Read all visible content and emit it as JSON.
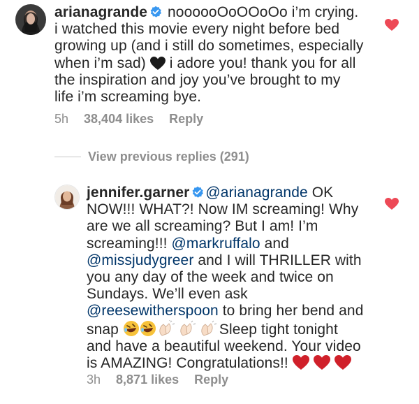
{
  "comment1": {
    "username": "arianagrande",
    "lines": [
      " noooooOoOOoOo i’m crying.",
      "i watched this movie every night before bed",
      "growing up (and i still do sometimes, especially",
      "when i’m sad)",
      " i adore you! thank you for all",
      "the inspiration and joy you’ve brought to my",
      "life i’m screaming bye."
    ],
    "time": "5h",
    "likes": "38,404 likes",
    "reply": "Reply"
  },
  "view_previous": "View previous replies (291)",
  "comment2": {
    "username": "jennifer.garner",
    "mention_ariana": "@arianagrande",
    "line1_tail": " OK",
    "lines": [
      "NOW!!! WHAT?! Now IM screaming!  Why",
      "are we all screaming? But I am! I’m",
      "screaming!!! ",
      " and",
      " and I will THRILLER with",
      "you any day of the week and twice on",
      "Sundays.  We’ll even ask",
      " to bring her bend and",
      "snap ",
      "Sleep tight tonight",
      "and have a beautiful weekend.  Your video",
      "is AMAZING! Congratulations!! "
    ],
    "mention_mark": "@markruffalo",
    "mention_judy": "@missjudygreer",
    "mention_reese": "@reesewitherspoon",
    "time": "3h",
    "likes": "8,871 likes",
    "reply": "Reply"
  },
  "colors": {
    "text": "#262626",
    "mention": "#003569",
    "meta": "#8e8e8e",
    "like_heart": "#ed4956",
    "verified": "#3897f0"
  }
}
